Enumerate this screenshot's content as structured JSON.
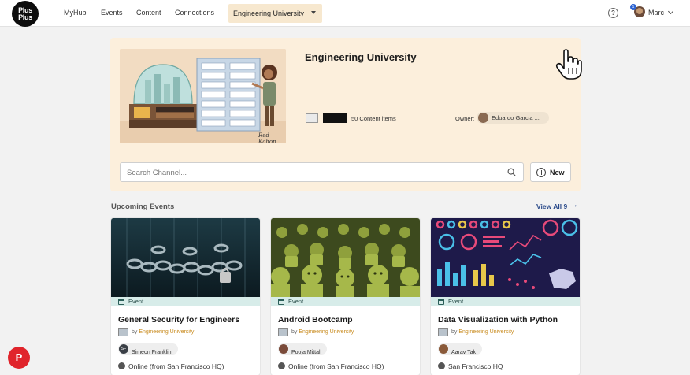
{
  "app": {
    "logo_line1": "Plus",
    "logo_line2": "Plus"
  },
  "nav": {
    "items": [
      "MyHub",
      "Events",
      "Content",
      "Connections"
    ],
    "channel_label": "Engineering University"
  },
  "user": {
    "name": "Marc",
    "notifications": "1",
    "icons": [
      "help-icon",
      "chevron-down-icon"
    ]
  },
  "channel": {
    "title": "Engineering University",
    "content_count": "50 Content items",
    "owner_label": "Owner:",
    "owner_name": "Eduardo Garcia ...",
    "search_placeholder": "Search Channel...",
    "new_label": "New",
    "banner_signature": "Red Kahon"
  },
  "events": {
    "section_title": "Upcoming Events",
    "view_all": "View All 9",
    "view_all_arrow": "→",
    "cards": [
      {
        "type": "Event",
        "title": "General Security for Engineers",
        "by": "by",
        "channel": "Engineering University",
        "host": "Simeon Franklin",
        "host_initials": "SF",
        "location": "Online (from San Francisco HQ)"
      },
      {
        "type": "Event",
        "title": "Android Bootcamp",
        "by": "by",
        "channel": "Engineering University",
        "host": "Pooja Mittal",
        "host_initials": "",
        "location": "Online (from San Francisco HQ)"
      },
      {
        "type": "Event",
        "title": "Data Visualization with Python",
        "by": "by",
        "channel": "Engineering University",
        "host": "Aarav Tak",
        "host_initials": "",
        "location": "San Francisco HQ"
      }
    ]
  },
  "fab": {
    "label": "P"
  },
  "colors": {
    "hero_bg": "#fcefdc",
    "channel_pill": "#f7e8cf",
    "event_tag": "#d7ece9",
    "channel_link": "#c88a1c",
    "fab": "#e0242b"
  }
}
